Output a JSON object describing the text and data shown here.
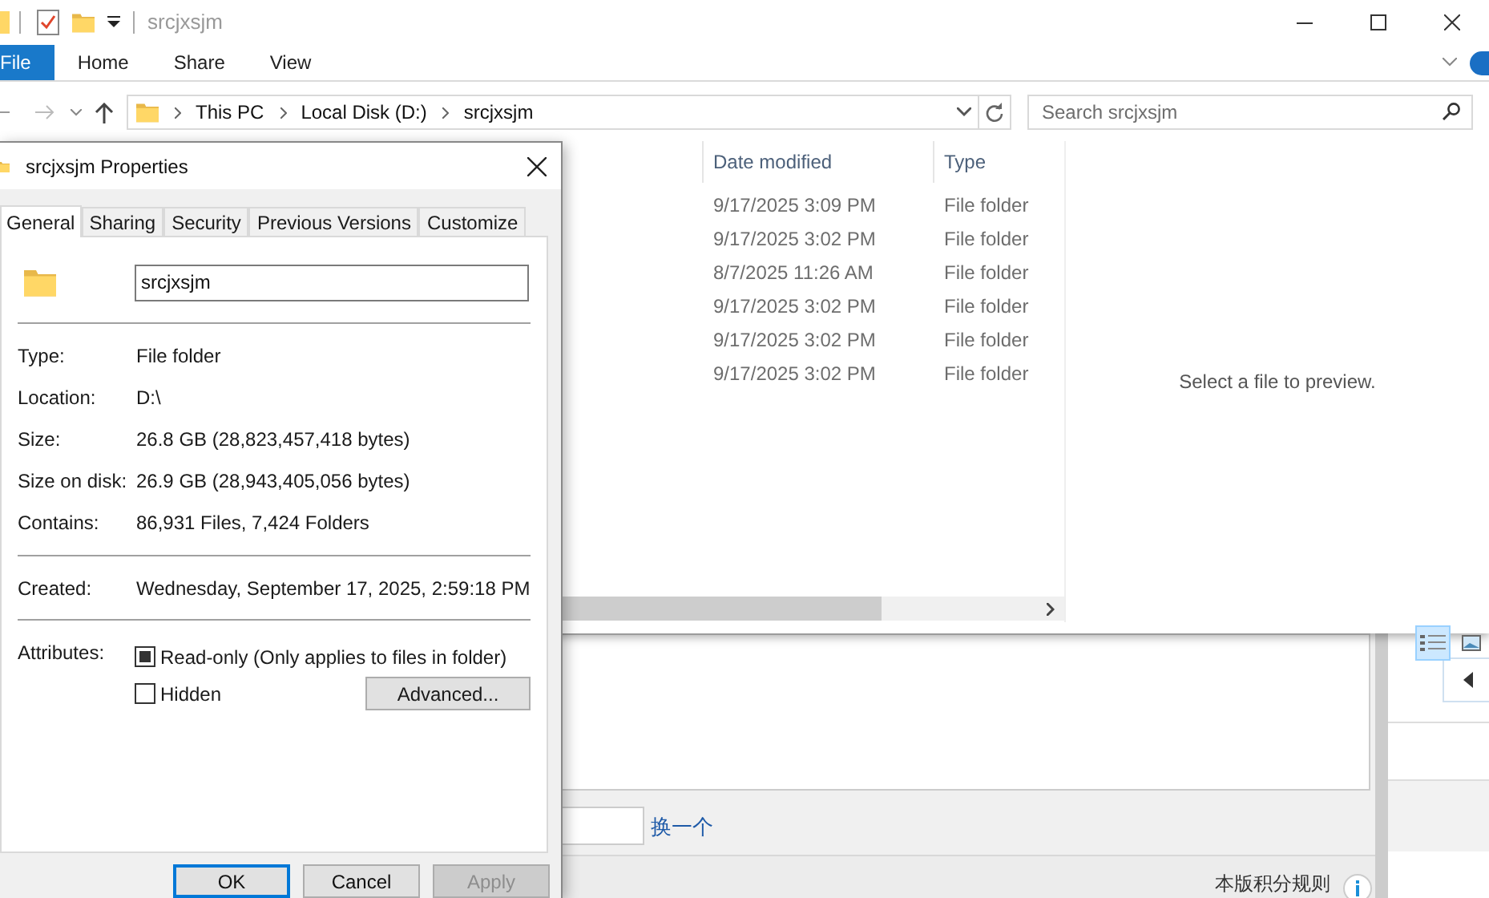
{
  "explorer": {
    "title": "srcjxsjm",
    "ribbon_tabs": [
      {
        "label": "File",
        "selected": true
      },
      {
        "label": "Home",
        "selected": false
      },
      {
        "label": "Share",
        "selected": false
      },
      {
        "label": "View",
        "selected": false
      }
    ],
    "breadcrumbs": [
      "This PC",
      "Local Disk (D:)",
      "srcjxsjm"
    ],
    "search": {
      "placeholder": "Search srcjxsjm"
    },
    "columns": [
      "Date modified",
      "Type"
    ],
    "rows": [
      {
        "date": "9/17/2025 3:09 PM",
        "type": "File folder"
      },
      {
        "date": "9/17/2025 3:02 PM",
        "type": "File folder"
      },
      {
        "date": "8/7/2025 11:26 AM",
        "type": "File folder"
      },
      {
        "date": "9/17/2025 3:02 PM",
        "type": "File folder"
      },
      {
        "date": "9/17/2025 3:02 PM",
        "type": "File folder"
      },
      {
        "date": "9/17/2025 3:02 PM",
        "type": "File folder"
      }
    ],
    "preview": "Select a file to preview.",
    "views": [
      {
        "kind": "details",
        "selected": true
      },
      {
        "kind": "thumbnails",
        "selected": false
      }
    ]
  },
  "dialog": {
    "title": "srcjxsjm Properties",
    "tabs": [
      {
        "label": "General",
        "selected": true
      },
      {
        "label": "Sharing",
        "selected": false
      },
      {
        "label": "Security",
        "selected": false
      },
      {
        "label": "Previous Versions",
        "selected": false
      },
      {
        "label": "Customize",
        "selected": false
      }
    ],
    "name_value": "srcjxsjm",
    "sections": [
      [
        {
          "label": "Type:",
          "value": "File folder"
        },
        {
          "label": "Location:",
          "value": "D:\\"
        },
        {
          "label": "Size:",
          "value": "26.8 GB (28,823,457,418 bytes)"
        },
        {
          "label": "Size on disk:",
          "value": "26.9 GB (28,943,405,056 bytes)"
        },
        {
          "label": "Contains:",
          "value": "86,931 Files, 7,424 Folders"
        }
      ],
      [
        {
          "label": "Created:",
          "value": "Wednesday, September 17, 2025, 2:59:18 PM"
        }
      ]
    ],
    "attributes_label": "Attributes:",
    "attributes": [
      {
        "label": "Read-only (Only applies to files in folder)",
        "checked": false,
        "indeterminate": true
      },
      {
        "label": "Hidden",
        "checked": false,
        "indeterminate": false
      }
    ],
    "advanced": "Advanced...",
    "buttons": [
      {
        "label": "OK",
        "kind": "default",
        "disabled": false
      },
      {
        "label": "Cancel",
        "kind": "normal",
        "disabled": false
      },
      {
        "label": "Apply",
        "kind": "normal",
        "disabled": true
      }
    ]
  },
  "web": {
    "refresh_link": "换一个",
    "rules_link": "本版积分规则"
  }
}
